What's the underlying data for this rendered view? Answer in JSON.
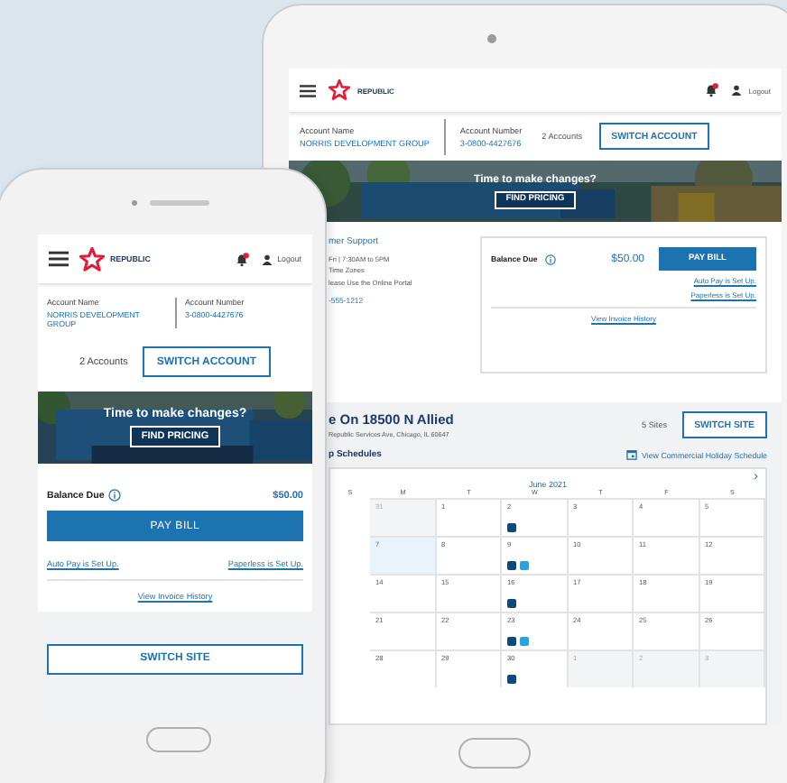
{
  "tablet": {
    "header": {
      "brand": "REPUBLIC",
      "logout": "Logout"
    },
    "account": {
      "name_label": "Account Name",
      "name": "NORRIS DEVELOPMENT GROUP",
      "number_label": "Account Number",
      "number": "3-0800-4427676",
      "count": "2 Accounts",
      "switch": "SWITCH ACCOUNT"
    },
    "banner": {
      "headline": "Time to make changes?",
      "button": "FIND PRICING"
    },
    "support": {
      "title": "mer Support",
      "lines": [
        "Fri | 7:30AM to 5PM",
        "Time Zones",
        "lease Use the Online Portal"
      ],
      "phone": "-555-1212"
    },
    "balance": {
      "label": "Balance Due",
      "amount": "$50.00",
      "pay": "PAY BILL",
      "links": [
        "Auto Pay is Set Up.",
        "Paperless is Set Up."
      ],
      "history": "View Invoice History"
    },
    "site": {
      "title": "e On 18500 N Allied",
      "address": "Republic Services Ave, Chicago, IL 60647",
      "count": "5 Sites",
      "switch": "SWITCH SITE"
    },
    "schedule": {
      "title": "p Schedules",
      "holiday_link": "View Commercial Holiday Schedule",
      "month": "June 2021",
      "next": "›",
      "weekdays": [
        "S",
        "M",
        "T",
        "W",
        "T",
        "F",
        "S"
      ],
      "weeks": [
        [
          {
            "day": "31",
            "other_month": true,
            "today": false
          },
          {
            "day": "1",
            "other_month": false,
            "today": false
          },
          {
            "day": "2",
            "other_month": false,
            "today": false,
            "pickups": [
              {
                "color": "#0d4a7c"
              }
            ]
          },
          {
            "day": "3",
            "other_month": false,
            "today": false
          },
          {
            "day": "4",
            "other_month": false,
            "today": false
          },
          {
            "day": "5",
            "other_month": false,
            "today": false
          }
        ],
        [
          {
            "day": "7",
            "other_month": false,
            "today": true
          },
          {
            "day": "8",
            "other_month": false,
            "today": false
          },
          {
            "day": "9",
            "other_month": false,
            "today": false,
            "pickups": [
              {
                "color": "#0d4a7c"
              },
              {
                "color": "#29a3e0"
              }
            ]
          },
          {
            "day": "10",
            "other_month": false,
            "today": false
          },
          {
            "day": "11",
            "other_month": false,
            "today": false
          },
          {
            "day": "12",
            "other_month": false,
            "today": false
          }
        ],
        [
          {
            "day": "14",
            "other_month": false,
            "today": false
          },
          {
            "day": "15",
            "other_month": false,
            "today": false
          },
          {
            "day": "16",
            "other_month": false,
            "today": false,
            "pickups": [
              {
                "color": "#0d4a7c"
              }
            ]
          },
          {
            "day": "17",
            "other_month": false,
            "today": false
          },
          {
            "day": "18",
            "other_month": false,
            "today": false
          },
          {
            "day": "19",
            "other_month": false,
            "today": false
          }
        ],
        [
          {
            "day": "21",
            "other_month": false,
            "today": false
          },
          {
            "day": "22",
            "other_month": false,
            "today": false
          },
          {
            "day": "23",
            "other_month": false,
            "today": false,
            "pickups": [
              {
                "color": "#0d4a7c"
              },
              {
                "color": "#29a3e0"
              }
            ]
          },
          {
            "day": "24",
            "other_month": false,
            "today": false
          },
          {
            "day": "25",
            "other_month": false,
            "today": false
          },
          {
            "day": "26",
            "other_month": false,
            "today": false
          }
        ],
        [
          {
            "day": "28",
            "other_month": false,
            "today": false
          },
          {
            "day": "29",
            "other_month": false,
            "today": false
          },
          {
            "day": "30",
            "other_month": false,
            "today": false,
            "pickups": [
              {
                "color": "#0d4a7c"
              }
            ]
          },
          {
            "day": "1",
            "other_month": true,
            "today": false
          },
          {
            "day": "2",
            "other_month": true,
            "today": false
          },
          {
            "day": "3",
            "other_month": true,
            "today": false
          }
        ]
      ]
    }
  },
  "phone": {
    "header": {
      "brand": "REPUBLIC",
      "logout": "Logout"
    },
    "account": {
      "name_label": "Account Name",
      "name": "NORRIS DEVELOPMENT GROUP",
      "number_label": "Account Number",
      "number": "3-0800-4427676",
      "count": "2 Accounts",
      "switch": "SWITCH ACCOUNT"
    },
    "banner": {
      "headline": "Time to make changes?",
      "button": "FIND PRICING"
    },
    "balance": {
      "label": "Balance Due",
      "amount": "$50.00",
      "pay": "PAY BILL",
      "links": [
        "Auto Pay is Set Up.",
        "Paperless is Set Up."
      ],
      "history": "View Invoice History"
    },
    "site": {
      "switch": "SWITCH SITE"
    }
  }
}
